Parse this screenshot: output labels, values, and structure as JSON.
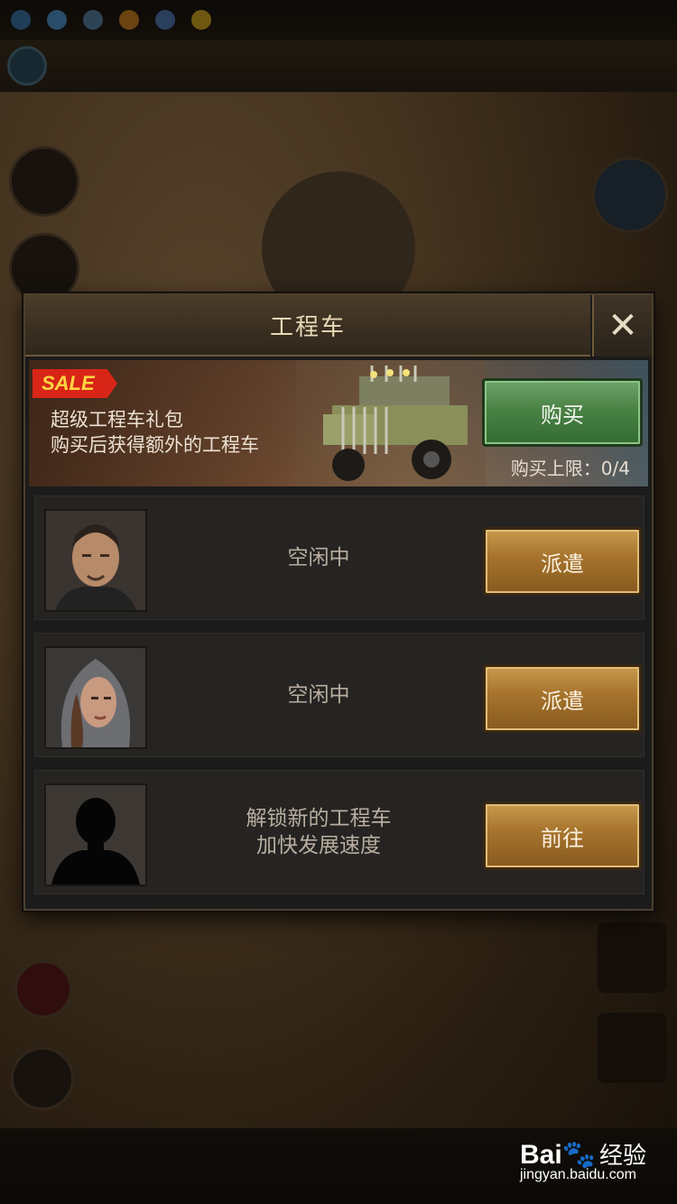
{
  "modal": {
    "title": "工程车",
    "close_label": "✕"
  },
  "sale": {
    "tag": "SALE",
    "line1": "超级工程车礼包",
    "line2": "购买后获得额外的工程车",
    "buy_label": "购买",
    "limit_label": "购买上限：0/4"
  },
  "rows": [
    {
      "status": "空闲中",
      "button": "派遣",
      "portrait": "commander-male"
    },
    {
      "status": "空闲中",
      "button": "派遣",
      "portrait": "commander-female-hood"
    },
    {
      "status_line1": "解锁新的工程车",
      "status_line2": "加快发展速度",
      "button": "前往",
      "portrait": "locked-silhouette"
    }
  ],
  "watermark": {
    "logo": "Bai🐾",
    "cn": "经验",
    "url": "jingyan.baidu.com"
  },
  "colors": {
    "gold_button": "#a8752e",
    "green_button": "#4a8245",
    "sale_red": "#d82517",
    "title_text": "#e9d9b6"
  }
}
